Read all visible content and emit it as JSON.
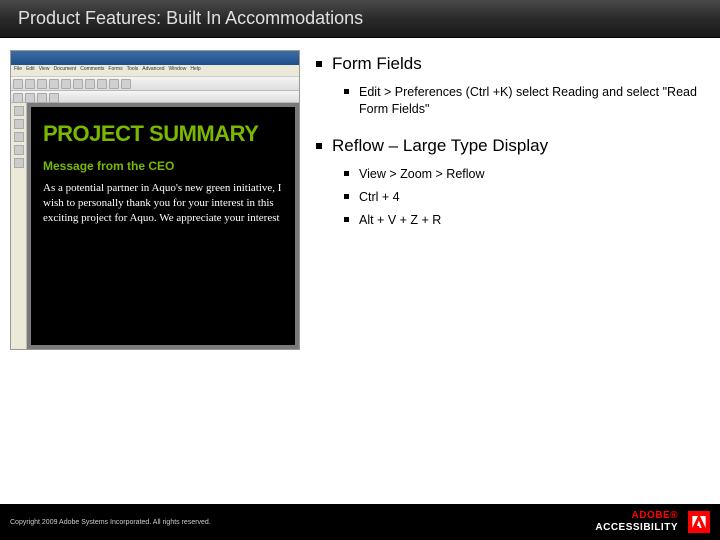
{
  "title": "Product Features: Built In Accommodations",
  "pdf": {
    "menu": [
      "File",
      "Edit",
      "View",
      "Document",
      "Comments",
      "Forms",
      "Tools",
      "Advanced",
      "Window",
      "Help"
    ],
    "doc": {
      "heading": "PROJECT SUMMARY",
      "subheading": "Message from the CEO",
      "body": "As a potential partner in Aquo's new green initiative, I wish to personally thank you for your interest in this exciting project for Aquo. We appreciate your interest"
    }
  },
  "sections": [
    {
      "heading": "Form Fields",
      "items": [
        "Edit > Preferences (Ctrl +K) select Reading and select \"Read Form Fields\""
      ]
    },
    {
      "heading": "Reflow – Large Type Display",
      "items": [
        "View > Zoom > Reflow",
        "Ctrl + 4",
        "Alt + V + Z + R"
      ]
    }
  ],
  "footer": {
    "copyright": "Copyright 2009 Adobe Systems Incorporated. All rights reserved.",
    "brand1": "ADOBE®",
    "brand2": "ACCESSIBILITY"
  }
}
